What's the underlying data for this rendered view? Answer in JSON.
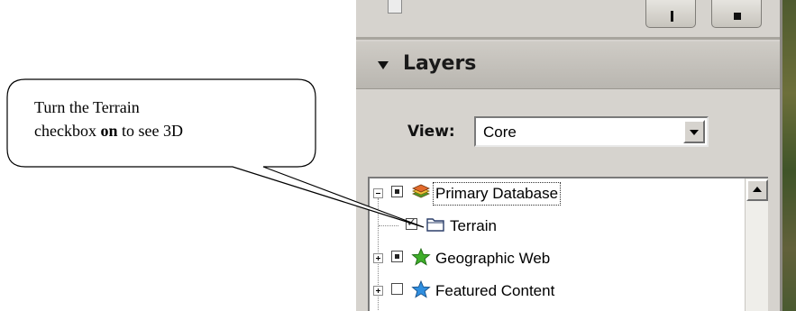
{
  "callout": {
    "line1": "Turn the Terrain",
    "line2_before": "checkbox ",
    "line2_bold": "on",
    "line2_after": " to see 3D"
  },
  "layers_panel": {
    "title": "Layers",
    "view_label": "View:",
    "view_value": "Core"
  },
  "tree": {
    "items": [
      {
        "label": "Primary Database",
        "checkbox": "partial",
        "expander": "minus",
        "icon": "database-layers-icon"
      },
      {
        "label": "Terrain",
        "checkbox": "checked",
        "expander": "none",
        "icon": "folder-icon"
      },
      {
        "label": "Geographic Web",
        "checkbox": "partial",
        "expander": "plus",
        "icon": "green-star-icon"
      },
      {
        "label": "Featured Content",
        "checkbox": "unchecked",
        "expander": "plus",
        "icon": "blue-star-icon"
      }
    ]
  },
  "colors": {
    "panel_bg": "#d6d3ce",
    "header_bg": "#c3c0ba",
    "green_star": "#3fae2a",
    "blue_star": "#2f8fe0"
  }
}
